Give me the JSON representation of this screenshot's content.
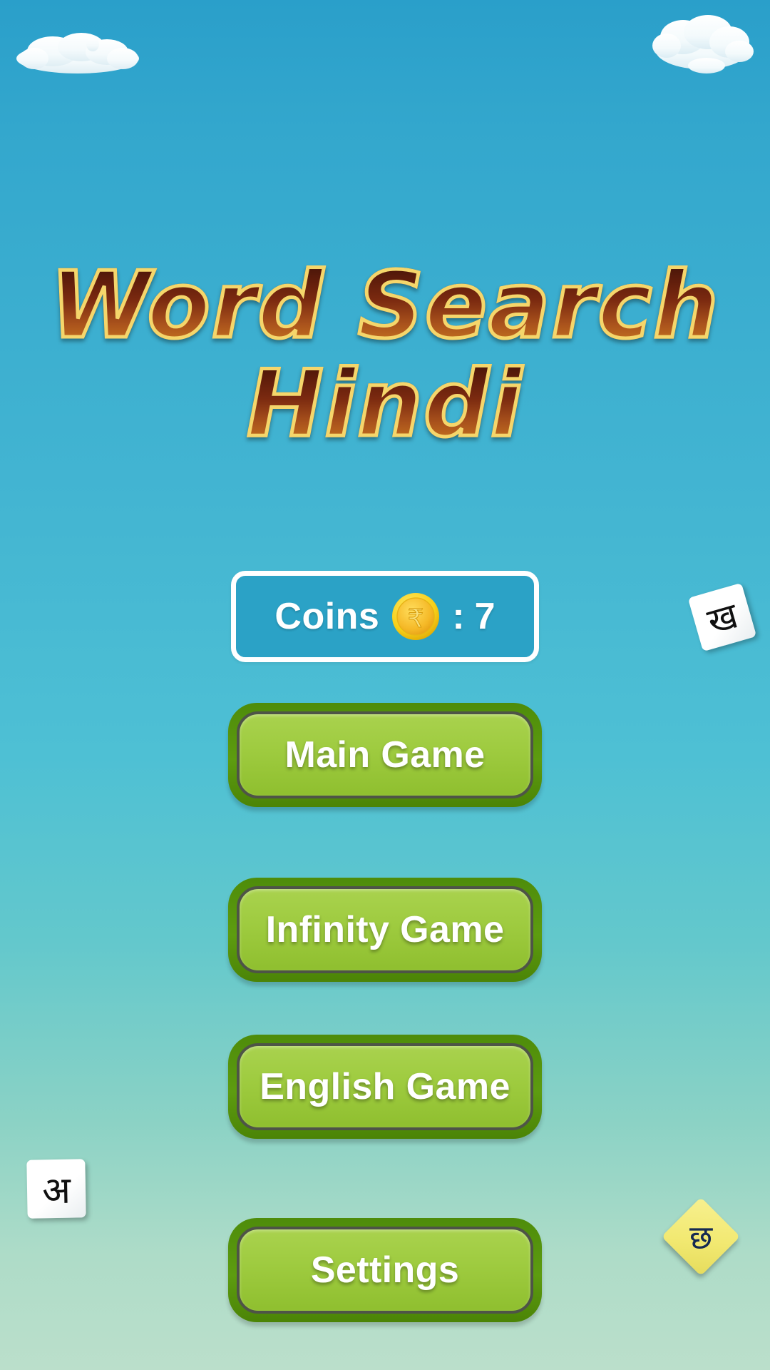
{
  "app": {
    "title_line1": "Word Search",
    "title_line2": "Hindi",
    "background_top_color": "#2a9fca",
    "background_bottom_color": "#bbdfcb"
  },
  "coins": {
    "label": "Coins",
    "separator": ":",
    "value": "7",
    "icon": "rupee-coin-icon",
    "coin_symbol": "₹",
    "panel_border_color": "#ffffff",
    "panel_fill_color": "#2ba2c6"
  },
  "menu": {
    "buttons": [
      {
        "id": "main-game",
        "label": "Main Game"
      },
      {
        "id": "infinity-game",
        "label": "Infinity Game"
      },
      {
        "id": "english-game",
        "label": "English Game"
      },
      {
        "id": "settings",
        "label": "Settings"
      }
    ],
    "button_frame_color": "#4e8c0a",
    "button_fill_color": "#9ecb3f",
    "button_text_color": "#ffffff"
  },
  "decorations": {
    "clouds": [
      {
        "id": "cloud-top-left",
        "name": "cloud-icon"
      },
      {
        "id": "cloud-top-right",
        "name": "cloud-icon"
      }
    ],
    "letter_tiles": [
      {
        "id": "tile-kha",
        "glyph": "ख",
        "color": "#ffffff",
        "text_color": "#101010"
      },
      {
        "id": "tile-a",
        "glyph": "अ",
        "color": "#ffffff",
        "text_color": "#101010"
      },
      {
        "id": "tile-chha",
        "glyph": "छ",
        "color": "#f2e972",
        "text_color": "#152a52"
      }
    ]
  }
}
